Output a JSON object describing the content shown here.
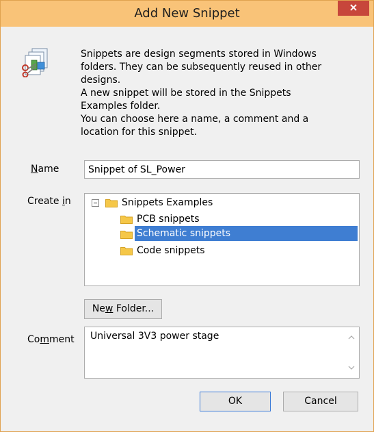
{
  "window": {
    "title": "Add New Snippet",
    "close_glyph": "×",
    "titlebar_color": "#f9c378",
    "close_color": "#c7463b",
    "icon": "snippets-scissors-icon"
  },
  "intro": {
    "lines": [
      "Snippets are design segments stored in Windows",
      "folders. They can be subsequently reused in other",
      "designs.",
      "A new snippet will be stored in the Snippets",
      "Examples folder.",
      "You can choose here a name, a comment and a",
      "location for this snippet."
    ]
  },
  "name": {
    "label_underlined": "N",
    "label_rest": "ame",
    "value": "Snippet of SL_Power"
  },
  "create_in": {
    "label_before": "Create ",
    "label_underlined": "i",
    "label_after": "n",
    "tree": {
      "root": "Snippets Examples",
      "children": [
        "PCB snippets",
        "Schematic snippets",
        "Code snippets"
      ],
      "selected_index": 1,
      "selection_color": "#3f7ed2"
    }
  },
  "new_folder": {
    "label_before": "Ne",
    "label_underlined": "w",
    "label_after": " Folder..."
  },
  "comment": {
    "label_before": "Co",
    "label_underlined": "m",
    "label_after": "ment",
    "value": "Universal 3V3 power stage"
  },
  "buttons": {
    "ok": "OK",
    "cancel": "Cancel"
  }
}
